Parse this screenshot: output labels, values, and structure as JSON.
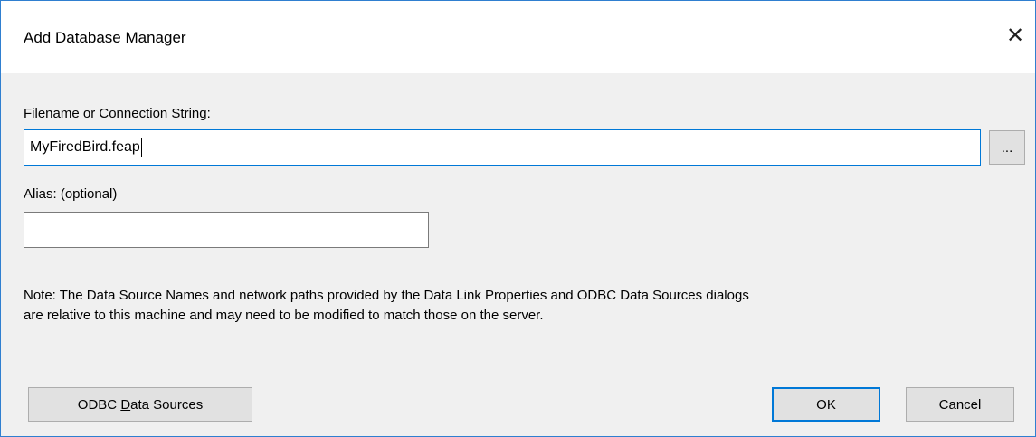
{
  "window": {
    "title": "Add Database Manager",
    "close_glyph": "✕"
  },
  "form": {
    "filename_label": "Filename or Connection String:",
    "filename_value": "MyFiredBird.feap",
    "browse_label": "...",
    "alias_label": "Alias: (optional)",
    "alias_value": ""
  },
  "note": {
    "line1": "Note: The Data Source Names and network paths provided by the Data Link Properties and ODBC Data Sources dialogs",
    "line2": "are relative to this machine and may need to be modified to match those on the server."
  },
  "buttons": {
    "odbc_prefix": "ODBC ",
    "odbc_mnemonic": "D",
    "odbc_suffix": "ata Sources",
    "ok": "OK",
    "cancel": "Cancel"
  },
  "colors": {
    "accent": "#0078d7",
    "window_border": "#2f7fd0",
    "dialog_bg": "#f0f0f0"
  }
}
